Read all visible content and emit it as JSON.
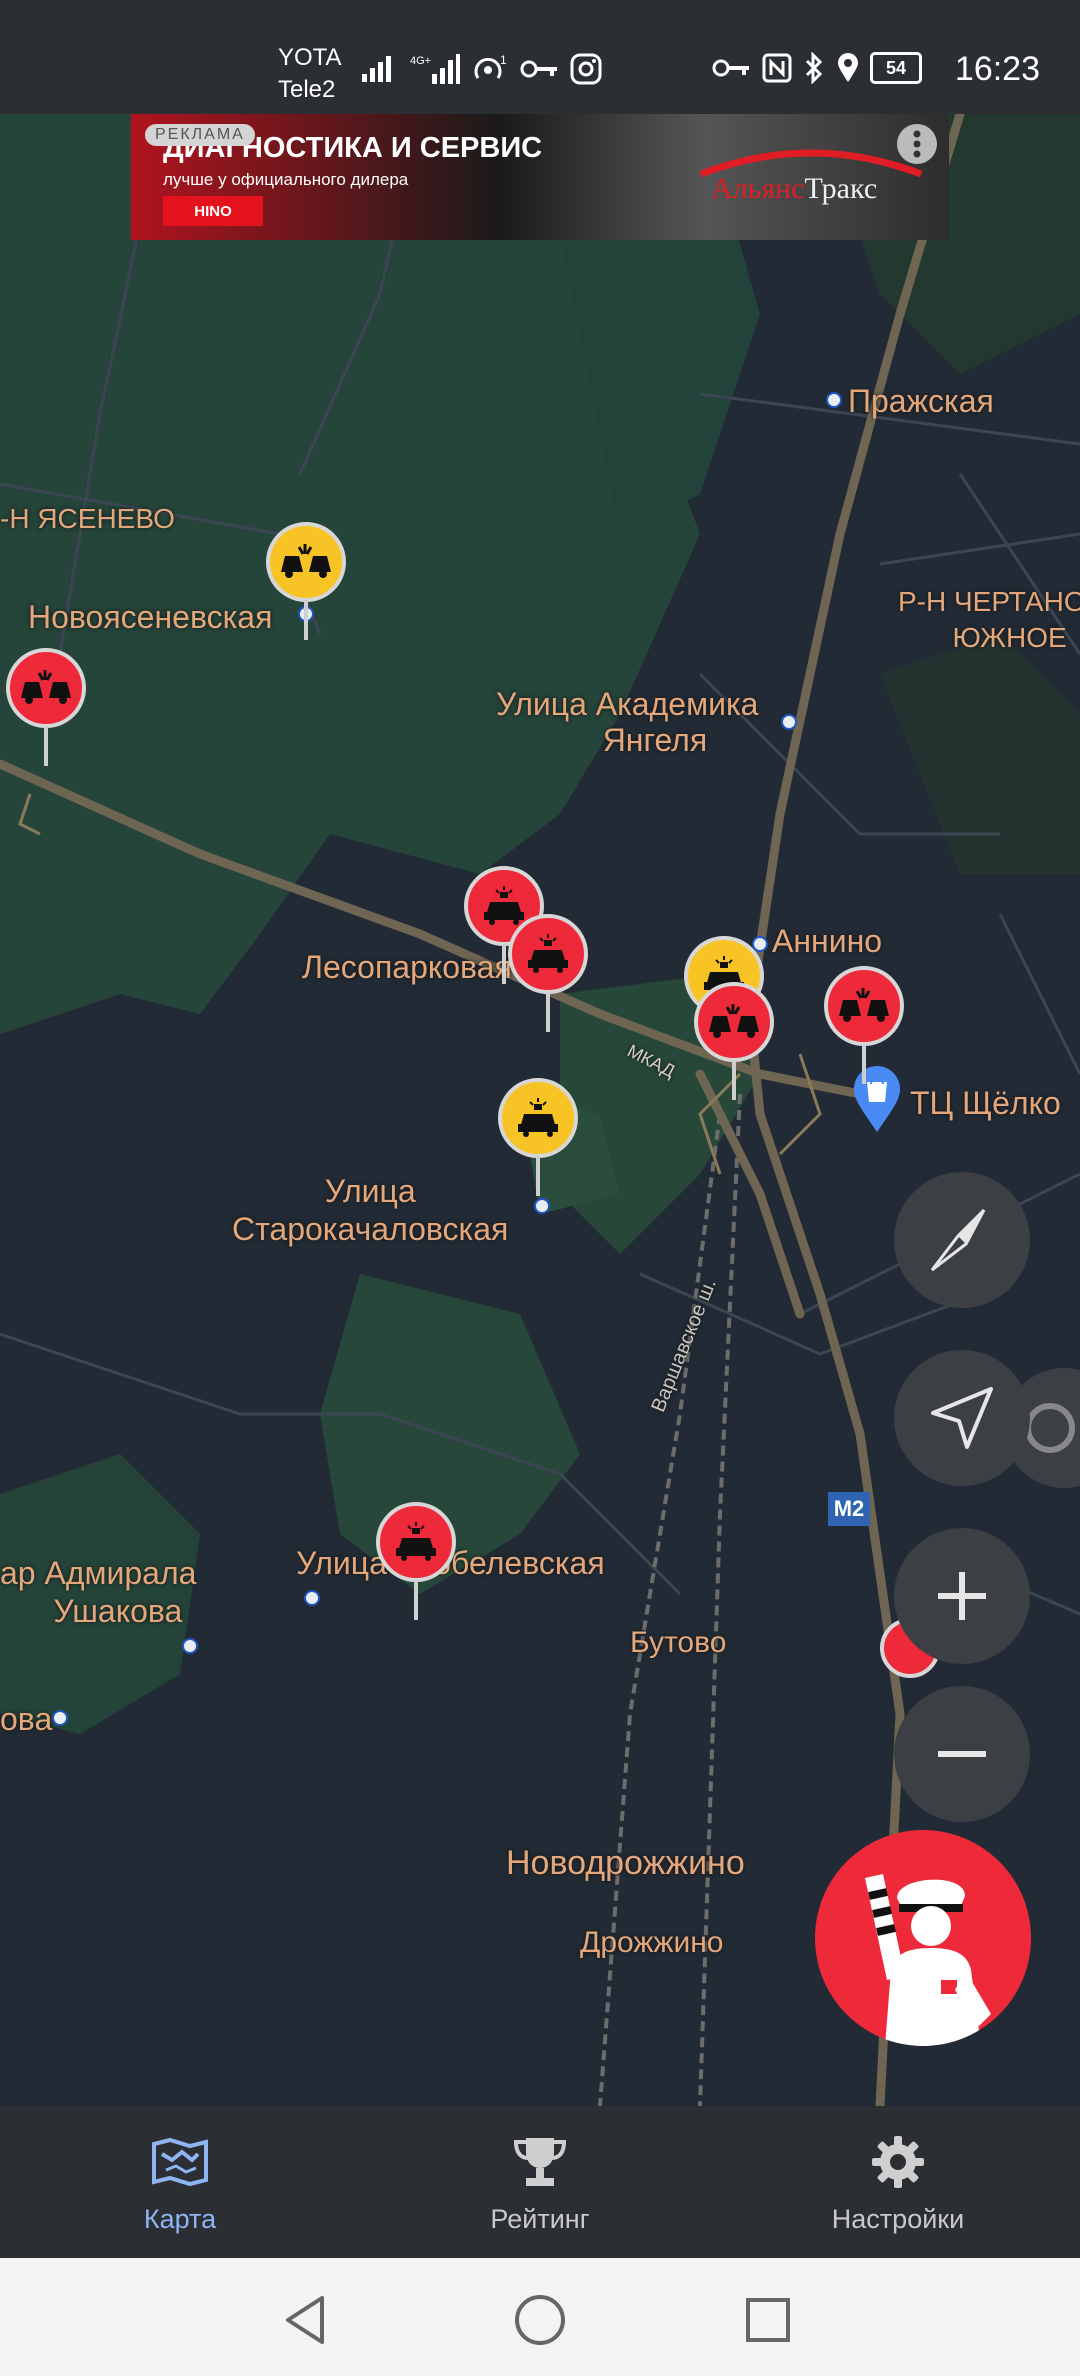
{
  "status_bar": {
    "carrier_top": "YOTA",
    "carrier_bottom": "Tele2",
    "battery": "54",
    "time": "16:23"
  },
  "ad": {
    "tag": "РЕКЛАМА",
    "title": "ДИАГНОСТИКА И СЕРВИС",
    "subtitle": "лучше у официального дилера",
    "hino": "HINO",
    "brand_part1": "Альянс",
    "brand_part2": "Тракс"
  },
  "map": {
    "labels": {
      "prazhskaya": "Пражская",
      "yasenevo": "-Н ЯСЕНЕВО",
      "novoyasenevskaya": "Новоясеневская",
      "chertanovo": "Р-Н ЧЕРТАНО\n       ЮЖНОЕ",
      "akademika_yangelya": "Улица Академика\n            Янгеля",
      "annino": "Аннино",
      "lesoparkovaya": "Лесопарковая",
      "mkad": "МКАД",
      "shchelkovo": "ТЦ Щёлко",
      "starokachalovskaya": "Улица\nСтарокачаловская",
      "varshavskoe": "Варшавское ш.",
      "m2": "M2",
      "admirala_ushakova": "ар Адмирала\n      Ушакова",
      "skobelevskaya": "Улица Скобелевская",
      "butovo": "Бутово",
      "ova": "ова",
      "novodrozhzhino": "Новодрожжино",
      "drozhzhino": "Дрожжино"
    }
  },
  "nav": {
    "map": "Карта",
    "rating": "Рейтинг",
    "settings": "Настройки"
  },
  "colors": {
    "map_bg": "#222b35",
    "forest": "#25443a",
    "label": "#e4a77b",
    "red_marker": "#ee2a3a",
    "yellow_marker": "#f7c325",
    "nav_active": "#8fb4f2"
  }
}
